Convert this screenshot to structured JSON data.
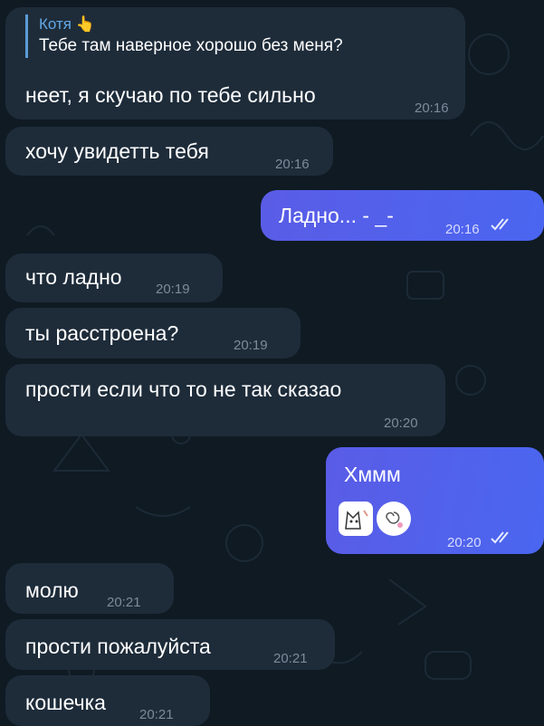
{
  "reply": {
    "sender": "Котя",
    "sender_emoji": "👆",
    "quoted_text": "Тебе там наверное хорошо без меня?"
  },
  "messages": [
    {
      "id": "m1",
      "text": "неет, я скучаю по тебе сильно",
      "time": "20:16"
    },
    {
      "id": "m2",
      "text": "хочу увидетть тебя",
      "time": "20:16"
    },
    {
      "id": "m3",
      "text": "Ладно... - _-",
      "time": "20:16"
    },
    {
      "id": "m4",
      "text": "что ладно",
      "time": "20:19"
    },
    {
      "id": "m5",
      "text": "ты расстроена?",
      "time": "20:19"
    },
    {
      "id": "m6",
      "text": "прости если что то не так сказао",
      "time": "20:20"
    },
    {
      "id": "m7",
      "text": "Хммм",
      "time": "20:20"
    },
    {
      "id": "m8",
      "text": "молю",
      "time": "20:21"
    },
    {
      "id": "m9",
      "text": "прости пожалуйста",
      "time": "20:21"
    },
    {
      "id": "m10",
      "text": "кошечка",
      "time": "20:21"
    }
  ],
  "colors": {
    "background": "#0f1a23",
    "incoming_bubble": "#1e2c3a",
    "outgoing_bubble": "#5a5ce6",
    "reply_accent": "#62a8e6"
  },
  "icons": {
    "read_receipt": "double-check-icon",
    "stickers": [
      "cat-sticker",
      "swirl-sticker"
    ]
  }
}
